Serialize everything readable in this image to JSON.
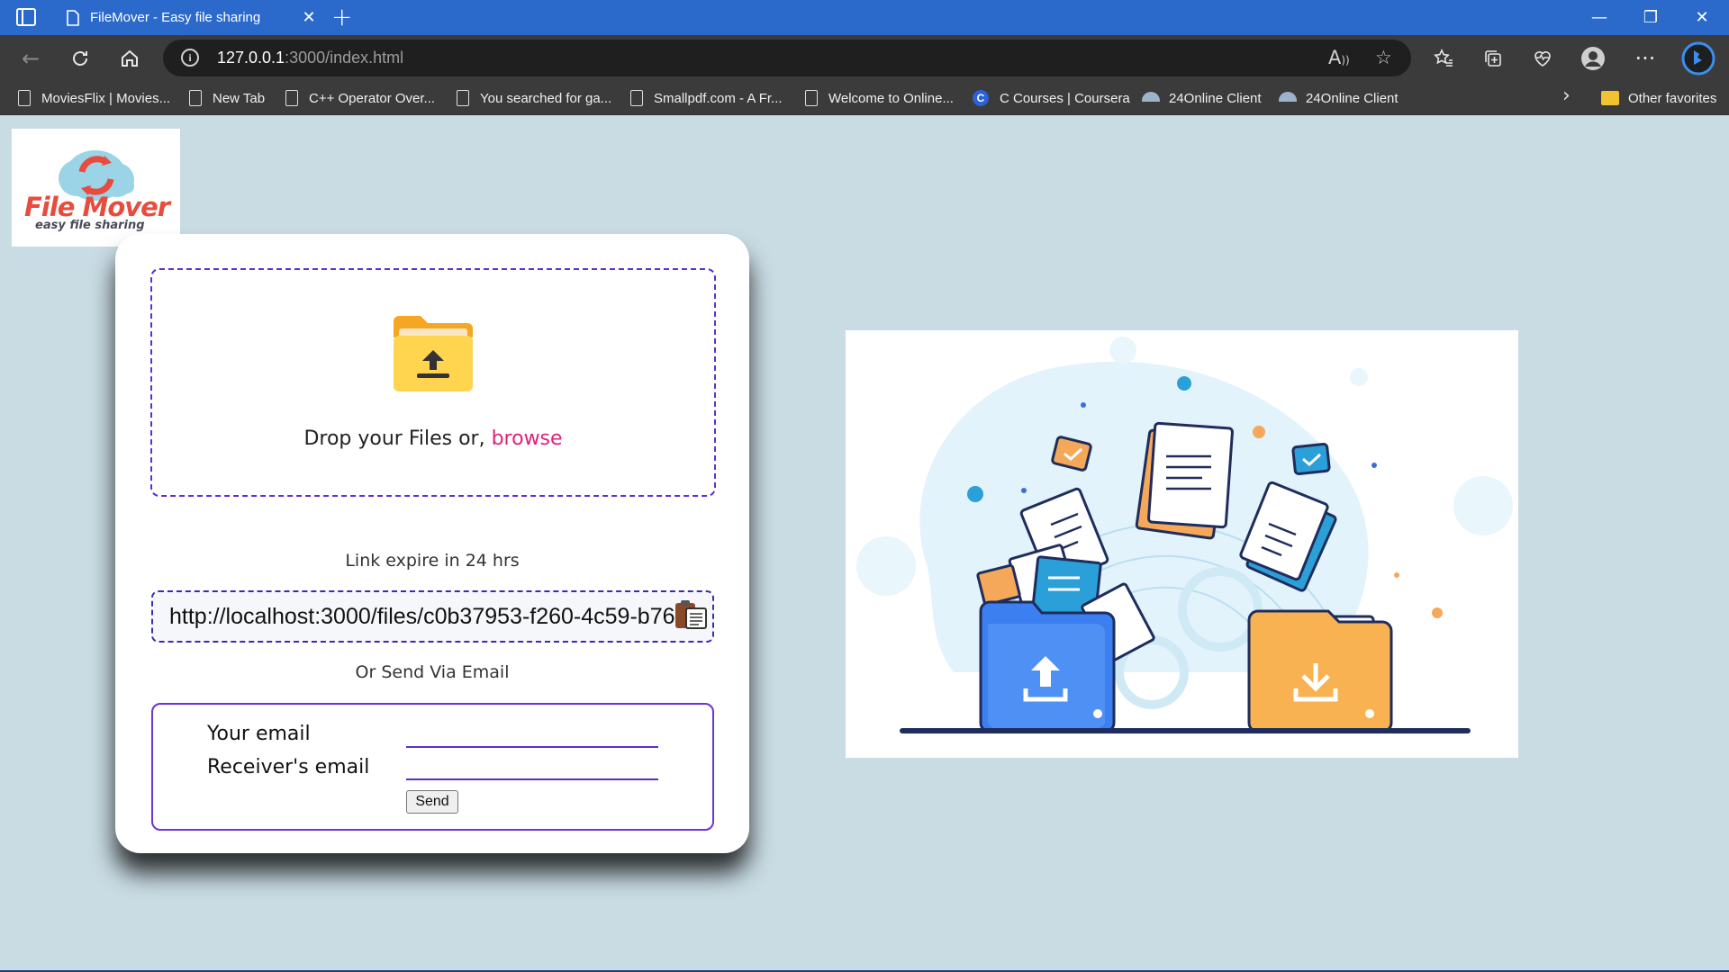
{
  "browser": {
    "tab_title": "FileMover - Easy file sharing",
    "tab_close": "✕",
    "new_tab": "+",
    "url_host": "127.0.0.1",
    "url_rest": ":3000/index.html",
    "window_controls": {
      "minimize": "—",
      "restore": "❐",
      "close": "✕"
    }
  },
  "favorites": [
    {
      "label": "MoviesFlix | Movies...",
      "icon": "doc"
    },
    {
      "label": "New Tab",
      "icon": "doc"
    },
    {
      "label": "C++ Operator Over...",
      "icon": "doc"
    },
    {
      "label": "You searched for ga...",
      "icon": "doc"
    },
    {
      "label": "Smallpdf.com - A Fr...",
      "icon": "doc"
    },
    {
      "label": "Welcome to Online...",
      "icon": "doc"
    },
    {
      "label": "C Courses | Coursera",
      "icon": "coursera"
    },
    {
      "label": "24Online Client",
      "icon": "dome"
    },
    {
      "label": "24Online Client",
      "icon": "dome"
    }
  ],
  "other_favorites": "Other favorites",
  "logo": {
    "title": "File Mover",
    "subtitle": "easy file sharing"
  },
  "upload": {
    "drop_text": "Drop your Files or, ",
    "browse_label": "browse",
    "expire_text": "Link expire in 24 hrs",
    "link_value": "http://localhost:3000/files/c0b37953-f260-4c59-b76",
    "or_send": "Or Send Via Email"
  },
  "email_form": {
    "your_email_label": "Your email",
    "receiver_email_label": "Receiver's email",
    "send_label": "Send"
  },
  "colors": {
    "page_bg": "#c9dbe3",
    "accent": "#6b34d6",
    "browse": "#e0207a",
    "logo_red": "#e84c3d"
  }
}
